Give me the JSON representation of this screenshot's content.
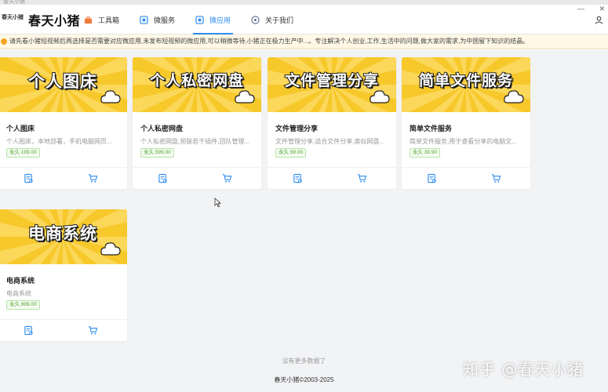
{
  "window": {
    "title_strip": "春天小猪"
  },
  "header": {
    "logo_text": "春天小猪",
    "brand": "春天小猪",
    "nav": [
      {
        "label": "工具箱",
        "icon": "toolbox-icon",
        "active": false
      },
      {
        "label": "微服务",
        "icon": "service-icon",
        "active": false
      },
      {
        "label": "微应用",
        "icon": "app-icon",
        "active": true
      },
      {
        "label": "关于我们",
        "icon": "info-icon",
        "active": false
      }
    ],
    "accent": "#2d8cf0"
  },
  "notice": {
    "text": "请先看小猪短视频后再选择是否需要对应微应用,未发布短视频的微应用,可以稍微等待,小猪正在极力生产中...。专注解决个人创业,工作,生活中的问题,做大家的需求,为中国留下知识的结晶。"
  },
  "cards": [
    {
      "banner": "个人图床",
      "title": "个人图床",
      "desc": "个人图床，本地部署，手机电脑网页同...",
      "tag": "永久 199.00"
    },
    {
      "banner": "个人私密网盘",
      "title": "个人私密网盘",
      "desc": "个人私密网盘,预装若干插件,团队管理...",
      "tag": "永久 599.00"
    },
    {
      "banner": "文件管理分享",
      "title": "文件管理分享",
      "desc": "文件管理分享,适合文件分享,类似网盘...",
      "tag": "永久 99.00"
    },
    {
      "banner": "简单文件服务",
      "title": "简单文件服务",
      "desc": "简单文件服务,用于查看分享的电脑文...",
      "tag": "永久 39.90"
    },
    {
      "banner": "电商系统",
      "title": "电商系统",
      "desc": "电商系统",
      "tag": "永久 999.00"
    }
  ],
  "status": {
    "no_more": "没有更多数据了"
  },
  "footer": {
    "copyright": "春天小猪©2003-2025"
  },
  "watermark": "知乎 @春天小猪",
  "colors": {
    "banner": "#f7c82a",
    "tag_green": "#52a535",
    "notice_bg": "#fff8e6"
  }
}
